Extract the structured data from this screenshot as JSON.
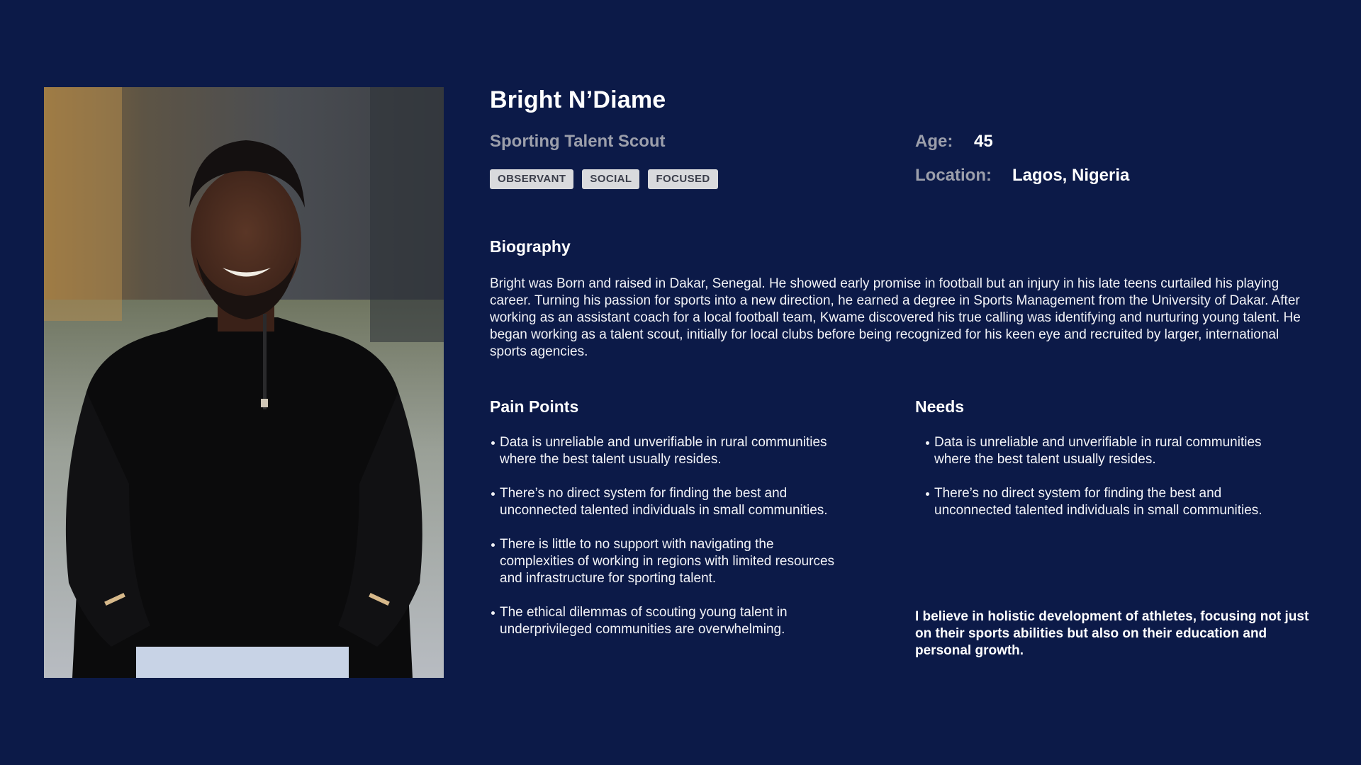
{
  "persona": {
    "name": "Bright N’Diame",
    "role": "Sporting Talent Scout",
    "traits": [
      "OBSERVANT",
      "SOCIAL",
      "FOCUSED"
    ],
    "age_label": "Age:",
    "age": "45",
    "location_label": "Location:",
    "location": "Lagos, Nigeria"
  },
  "biography": {
    "title": "Biography",
    "text": "Bright was Born and raised in Dakar, Senegal. He showed early promise in football but an injury in his late teens curtailed his playing career. Turning his passion for sports into a new direction, he earned a degree in Sports Management from the University of Dakar. After working as an assistant coach for a local football team, Kwame discovered his true calling was identifying and nurturing young talent. He began working as a talent scout, initially for local clubs before being recognized for his keen eye and recruited by larger, international sports agencies."
  },
  "pain_points": {
    "title": "Pain Points",
    "items": [
      "Data is unreliable and unverifiable in rural communities where the best talent usually resides.",
      "There’s no direct system for finding the best and unconnected talented individuals in small communities.",
      "There is little to no support with navigating the complexities of working in regions with limited resources and infrastructure for sporting talent.",
      "The ethical dilemmas of scouting young talent in underprivileged communities are overwhelming."
    ]
  },
  "needs": {
    "title": "Needs",
    "items": [
      "Data is unreliable and unverifiable in rural communities where the best talent usually resides.",
      "There’s no direct system for finding the best and unconnected talented individuals in small communities."
    ]
  },
  "quote": "I believe in holistic development of athletes, focusing not just on their sports abilities but also on their education and personal growth.",
  "colors": {
    "background": "#0c1a48",
    "muted_text": "#9c9fab",
    "tag_background": "#d9dadd",
    "tag_text": "#3a3d4a"
  }
}
